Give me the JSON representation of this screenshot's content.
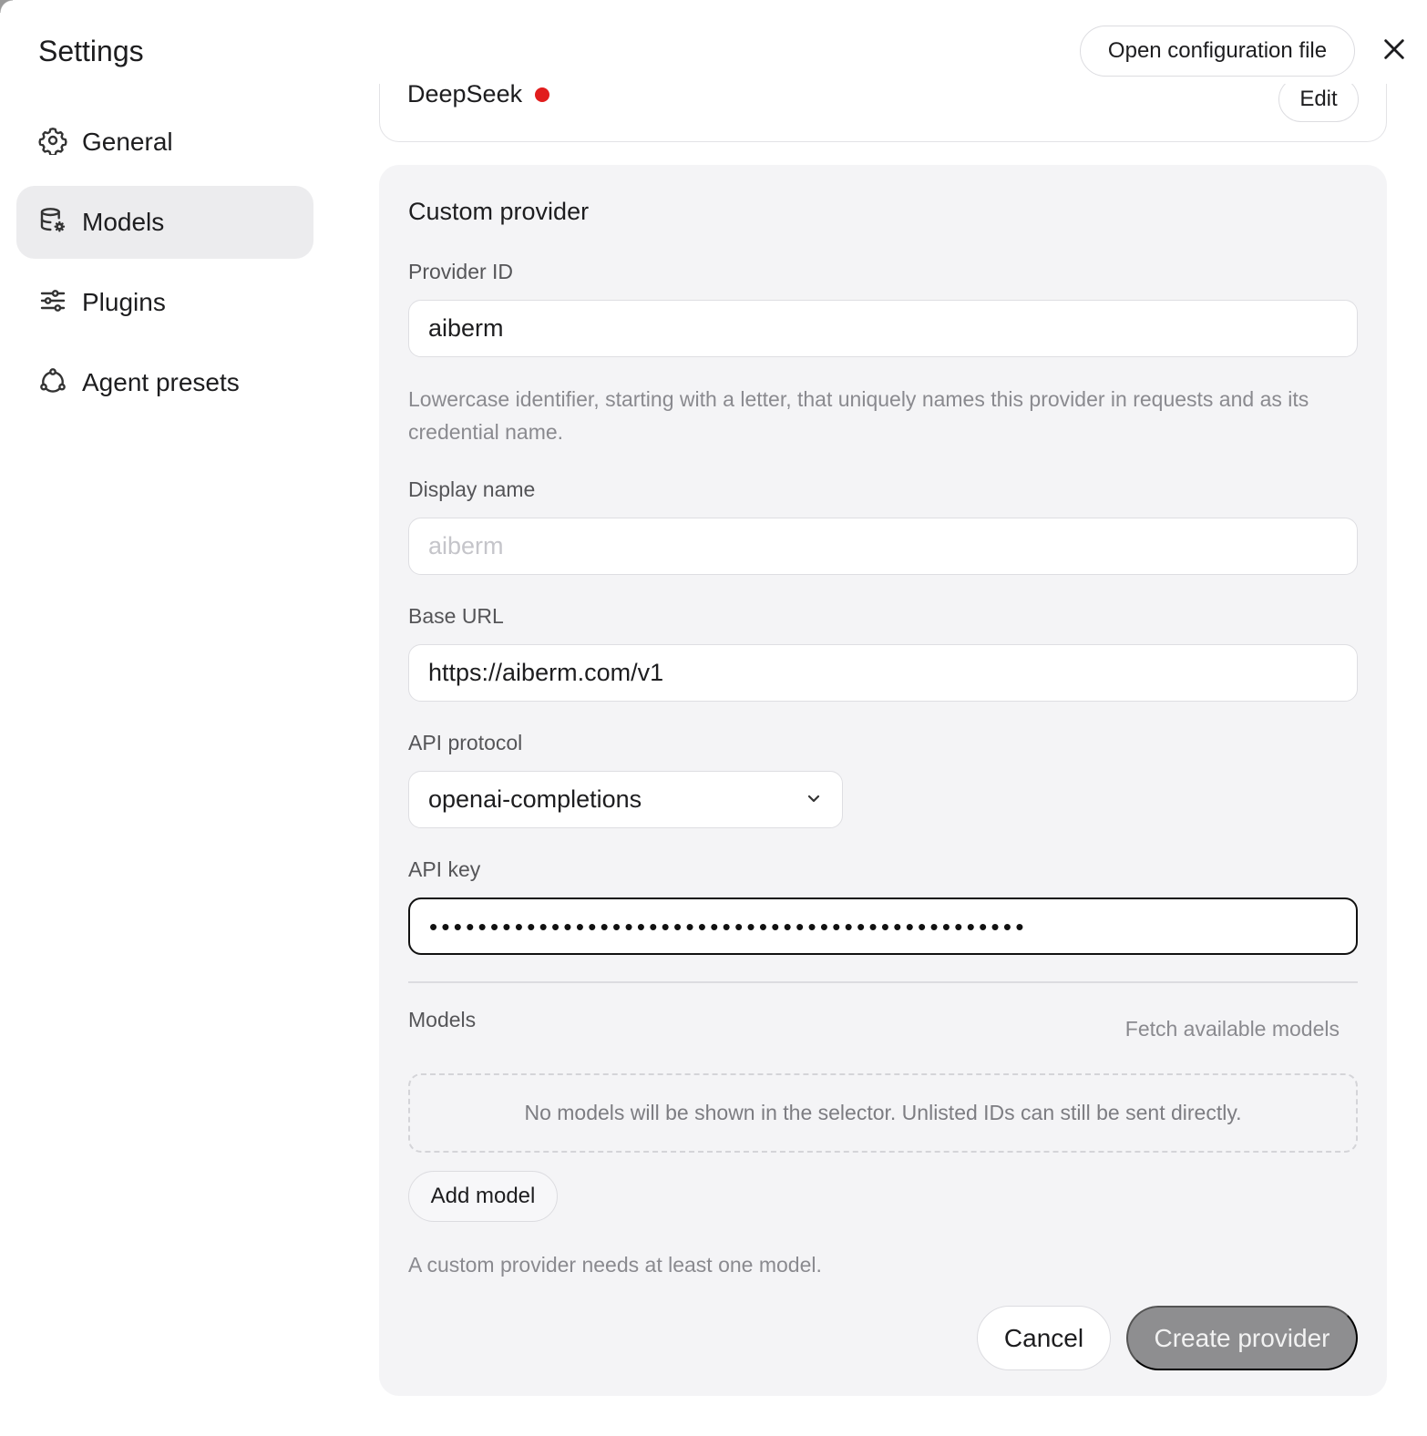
{
  "sidebar": {
    "title": "Settings",
    "items": [
      {
        "label": "General",
        "icon": "gear-icon"
      },
      {
        "label": "Models",
        "icon": "database-gear-icon",
        "active": true
      },
      {
        "label": "Plugins",
        "icon": "sliders-icon"
      },
      {
        "label": "Agent presets",
        "icon": "cycle-icon"
      }
    ]
  },
  "header": {
    "open_config_label": "Open configuration file",
    "close_icon": "close-icon"
  },
  "existing_provider": {
    "name": "DeepSeek",
    "status_color": "#e11d1d",
    "edit_label": "Edit"
  },
  "custom_provider": {
    "title": "Custom provider",
    "provider_id": {
      "label": "Provider ID",
      "value": "aiberm",
      "hint": "Lowercase identifier, starting with a letter, that uniquely names this provider in requests and as its credential name."
    },
    "display_name": {
      "label": "Display name",
      "placeholder": "aiberm"
    },
    "base_url": {
      "label": "Base URL",
      "value": "https://aiberm.com/v1"
    },
    "api_protocol": {
      "label": "API protocol",
      "value": "openai-completions"
    },
    "api_key": {
      "label": "API key",
      "masked_value": "•••••••••••••••••••••••••••••••••••••••••••••••••"
    },
    "models": {
      "label": "Models",
      "fetch_label": "Fetch available models",
      "empty_text": "No models will be shown in the selector. Unlisted IDs can still be sent directly.",
      "add_label": "Add model",
      "requirement_hint": "A custom provider needs at least one model."
    },
    "actions": {
      "cancel_label": "Cancel",
      "create_label": "Create provider",
      "create_disabled_color": "#8e8e90"
    }
  }
}
